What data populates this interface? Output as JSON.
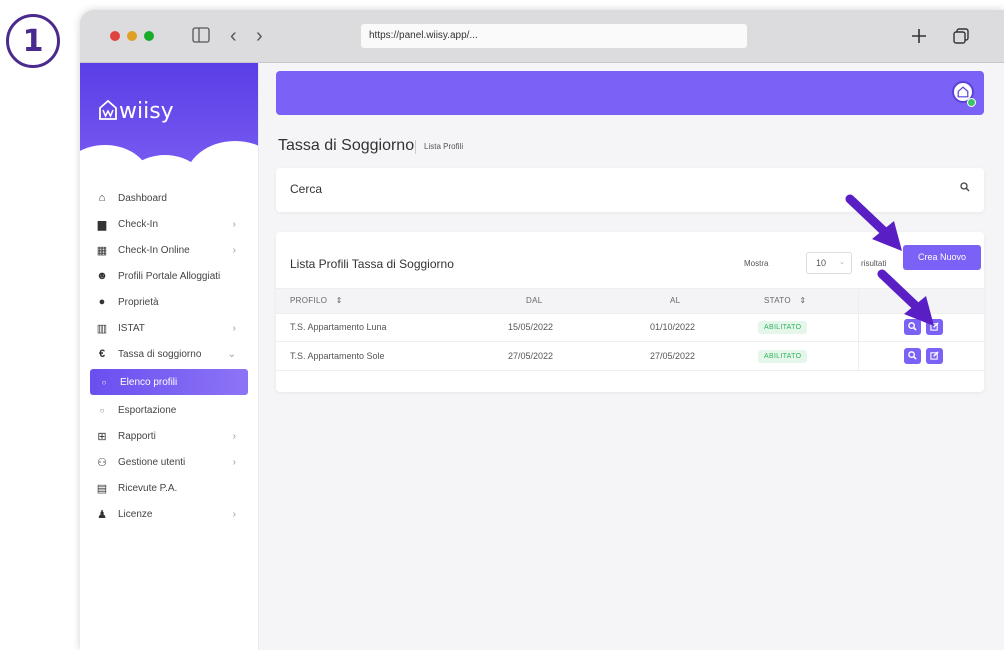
{
  "step_number": "1",
  "browser": {
    "url": "https://panel.wiisy.app/...",
    "new_tab_icon": "plus-icon",
    "tabs_icon": "tabs-overview-icon"
  },
  "brand": {
    "name": "wiisy",
    "color": "#6a4ff0"
  },
  "sidebar": {
    "items": [
      {
        "label": "Dashboard",
        "icon": "home-icon",
        "has_chevron": false
      },
      {
        "label": "Check-In",
        "icon": "book-icon",
        "has_chevron": true
      },
      {
        "label": "Check-In Online",
        "icon": "calendar-check-icon",
        "has_chevron": true
      },
      {
        "label": "Profili Portale Alloggiati",
        "icon": "users-id-icon",
        "has_chevron": false
      },
      {
        "label": "Proprietà",
        "icon": "map-marker-icon",
        "has_chevron": false
      },
      {
        "label": "ISTAT",
        "icon": "bar-chart-icon",
        "has_chevron": true
      },
      {
        "label": "Tassa di soggiorno",
        "icon": "euro-icon",
        "has_chevron": true,
        "expanded": true
      },
      {
        "label": "Elenco profili",
        "icon": "circle-icon",
        "active": true
      },
      {
        "label": "Esportazione",
        "icon": "circle-icon"
      },
      {
        "label": "Rapporti",
        "icon": "table-icon",
        "has_chevron": true
      },
      {
        "label": "Gestione utenti",
        "icon": "users-icon",
        "has_chevron": true
      },
      {
        "label": "Ricevute P.A.",
        "icon": "receipt-icon",
        "has_chevron": false
      },
      {
        "label": "Licenze",
        "icon": "user-key-icon",
        "has_chevron": true
      }
    ]
  },
  "page": {
    "title": "Tassa di Soggiorno",
    "breadcrumb": "Lista Profili"
  },
  "search": {
    "label": "Cerca",
    "icon": "search-icon"
  },
  "list": {
    "title": "Lista Profili Tassa di Soggiorno",
    "show_label": "Mostra",
    "per_page": "10",
    "results_label": "risultati",
    "create_button": "Crea Nuovo",
    "columns": [
      "PROFILO",
      "DAL",
      "AL",
      "STATO",
      ""
    ],
    "sort_icon": "sort-icon",
    "rows": [
      {
        "profile": "T.S. Appartamento Luna",
        "from": "15/05/2022",
        "to": "01/10/2022",
        "status": "ABILITATO"
      },
      {
        "profile": "T.S. Appartamento Sole",
        "from": "27/05/2022",
        "to": "27/05/2022",
        "status": "ABILITATO"
      }
    ]
  },
  "colors": {
    "accent": "#7b61f5",
    "annotation_arrow": "#5a1fc4",
    "status_green": "#2fb45d"
  }
}
